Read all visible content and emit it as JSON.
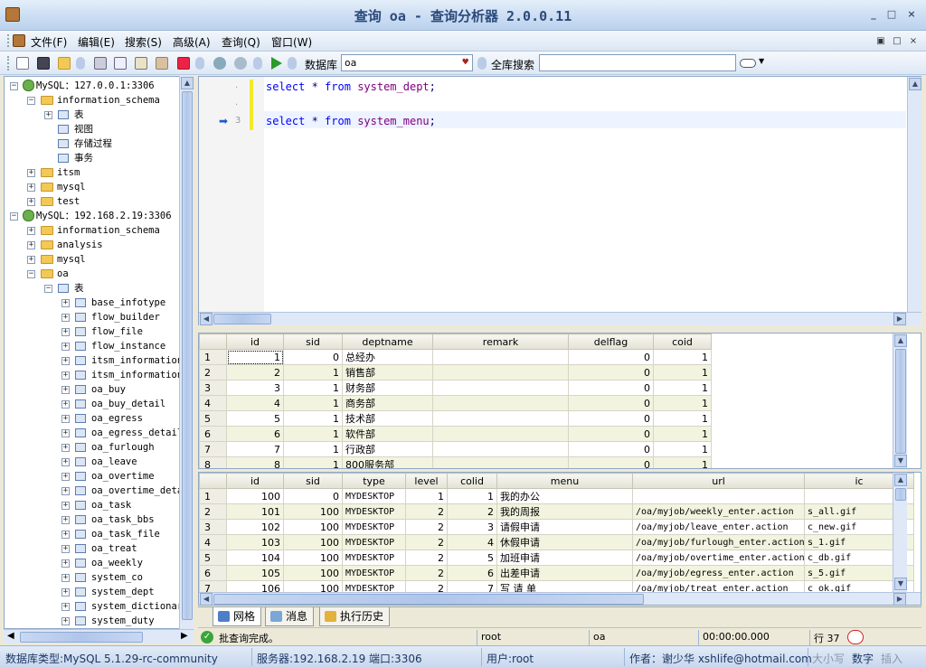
{
  "window": {
    "title": "查询 oa - 查询分析器 2.0.0.11"
  },
  "menu": [
    "文件(F)",
    "编辑(E)",
    "搜索(S)",
    "高级(A)",
    "查询(Q)",
    "窗口(W)"
  ],
  "toolbar": {
    "db_label": "数据库",
    "db_value": "oa",
    "search_label": "全库搜索",
    "search_value": ""
  },
  "tree": [
    {
      "level": 0,
      "kind": "server",
      "label": "MySQL：127.0.0.1:3306",
      "exp": "−"
    },
    {
      "level": 1,
      "kind": "folder",
      "label": "information_schema",
      "exp": "−"
    },
    {
      "level": 2,
      "kind": "table",
      "label": "表",
      "exp": "+"
    },
    {
      "level": 2,
      "kind": "table",
      "label": "视图",
      "exp": ""
    },
    {
      "level": 2,
      "kind": "table",
      "label": "存储过程",
      "exp": ""
    },
    {
      "level": 2,
      "kind": "table",
      "label": "事务",
      "exp": ""
    },
    {
      "level": 1,
      "kind": "folder",
      "label": "itsm",
      "exp": "+"
    },
    {
      "level": 1,
      "kind": "folder",
      "label": "mysql",
      "exp": "+"
    },
    {
      "level": 1,
      "kind": "folder",
      "label": "test",
      "exp": "+"
    },
    {
      "level": 0,
      "kind": "server",
      "label": "MySQL：192.168.2.19:3306",
      "exp": "−"
    },
    {
      "level": 1,
      "kind": "folder",
      "label": "information_schema",
      "exp": "+"
    },
    {
      "level": 1,
      "kind": "folder",
      "label": "analysis",
      "exp": "+"
    },
    {
      "level": 1,
      "kind": "folder",
      "label": "mysql",
      "exp": "+"
    },
    {
      "level": 1,
      "kind": "folder",
      "label": "oa",
      "exp": "−"
    },
    {
      "level": 2,
      "kind": "table",
      "label": "表",
      "exp": "−"
    },
    {
      "level": 3,
      "kind": "table",
      "label": "base_infotype",
      "exp": "+"
    },
    {
      "level": 3,
      "kind": "table",
      "label": "flow_builder",
      "exp": "+"
    },
    {
      "level": 3,
      "kind": "table",
      "label": "flow_file",
      "exp": "+"
    },
    {
      "level": 3,
      "kind": "table",
      "label": "flow_instance",
      "exp": "+"
    },
    {
      "level": 3,
      "kind": "table",
      "label": "itsm_information",
      "exp": "+"
    },
    {
      "level": 3,
      "kind": "table",
      "label": "itsm_information",
      "exp": "+"
    },
    {
      "level": 3,
      "kind": "table",
      "label": "oa_buy",
      "exp": "+"
    },
    {
      "level": 3,
      "kind": "table",
      "label": "oa_buy_detail",
      "exp": "+"
    },
    {
      "level": 3,
      "kind": "table",
      "label": "oa_egress",
      "exp": "+"
    },
    {
      "level": 3,
      "kind": "table",
      "label": "oa_egress_detail",
      "exp": "+"
    },
    {
      "level": 3,
      "kind": "table",
      "label": "oa_furlough",
      "exp": "+"
    },
    {
      "level": 3,
      "kind": "table",
      "label": "oa_leave",
      "exp": "+"
    },
    {
      "level": 3,
      "kind": "table",
      "label": "oa_overtime",
      "exp": "+"
    },
    {
      "level": 3,
      "kind": "table",
      "label": "oa_overtime_deta",
      "exp": "+"
    },
    {
      "level": 3,
      "kind": "table",
      "label": "oa_task",
      "exp": "+"
    },
    {
      "level": 3,
      "kind": "table",
      "label": "oa_task_bbs",
      "exp": "+"
    },
    {
      "level": 3,
      "kind": "table",
      "label": "oa_task_file",
      "exp": "+"
    },
    {
      "level": 3,
      "kind": "table",
      "label": "oa_treat",
      "exp": "+"
    },
    {
      "level": 3,
      "kind": "table",
      "label": "oa_weekly",
      "exp": "+"
    },
    {
      "level": 3,
      "kind": "table",
      "label": "system_co",
      "exp": "+"
    },
    {
      "level": 3,
      "kind": "table",
      "label": "system_dept",
      "exp": "+"
    },
    {
      "level": 3,
      "kind": "table",
      "label": "system_dictionar",
      "exp": "+"
    },
    {
      "level": 3,
      "kind": "table",
      "label": "system_duty",
      "exp": "+"
    }
  ],
  "editor": {
    "line_marks": [
      ".",
      ".",
      "3"
    ],
    "lines": [
      "select * from system_dept;",
      "",
      "select * from system_menu;"
    ]
  },
  "grid1": {
    "columns": [
      "id",
      "sid",
      "deptname",
      "remark",
      "delflag",
      "coid"
    ],
    "rows": [
      [
        "1",
        "0",
        "总经办",
        "",
        "0",
        "1"
      ],
      [
        "2",
        "1",
        "销售部",
        "",
        "0",
        "1"
      ],
      [
        "3",
        "1",
        "财务部",
        "",
        "0",
        "1"
      ],
      [
        "4",
        "1",
        "商务部",
        "",
        "0",
        "1"
      ],
      [
        "5",
        "1",
        "技术部",
        "",
        "0",
        "1"
      ],
      [
        "6",
        "1",
        "软件部",
        "",
        "0",
        "1"
      ],
      [
        "7",
        "1",
        "行政部",
        "",
        "0",
        "1"
      ],
      [
        "8",
        "1",
        "800服务部",
        "",
        "0",
        "1"
      ]
    ]
  },
  "grid2": {
    "columns": [
      "id",
      "sid",
      "type",
      "level",
      "colid",
      "menu",
      "url",
      "ic"
    ],
    "rows": [
      [
        "100",
        "0",
        "MYDESKTOP",
        "1",
        "1",
        "我的办公",
        "",
        ""
      ],
      [
        "101",
        "100",
        "MYDESKTOP",
        "2",
        "2",
        "我的周报",
        "/oa/myjob/weekly_enter.action",
        "s_all.gif"
      ],
      [
        "102",
        "100",
        "MYDESKTOP",
        "2",
        "3",
        "请假申请",
        "/oa/myjob/leave_enter.action",
        "c_new.gif"
      ],
      [
        "103",
        "100",
        "MYDESKTOP",
        "2",
        "4",
        "休假申请",
        "/oa/myjob/furlough_enter.action",
        "s_1.gif"
      ],
      [
        "104",
        "100",
        "MYDESKTOP",
        "2",
        "5",
        "加班申请",
        "/oa/myjob/overtime_enter.action",
        "c_db.gif"
      ],
      [
        "105",
        "100",
        "MYDESKTOP",
        "2",
        "6",
        "出差申请",
        "/oa/myjob/egress_enter.action",
        "s_5.gif"
      ],
      [
        "106",
        "100",
        "MYDESKTOP",
        "2",
        "7",
        "写 请 单",
        "/oa/myjob/treat_enter.action",
        "c_ok.gif"
      ]
    ]
  },
  "tabs": [
    "网格",
    "消息",
    "执行历史"
  ],
  "status": {
    "message": "批查询完成。",
    "user": "root",
    "db": "oa",
    "time": "00:00:00.000",
    "row": "行 37"
  },
  "bottom": {
    "dbtype": "数据库类型:MySQL 5.1.29-rc-community",
    "server": "服务器:192.168.2.19  端口:3306",
    "user": "用户:root",
    "author": "作者：谢少华 xshlife@hotmail.com",
    "caps": "大小写",
    "num": "数字",
    "insert": "插入"
  },
  "colors": {
    "accent": "#2c4a7c",
    "grid_alt": "#f2f4df",
    "keyword": "#000080"
  }
}
